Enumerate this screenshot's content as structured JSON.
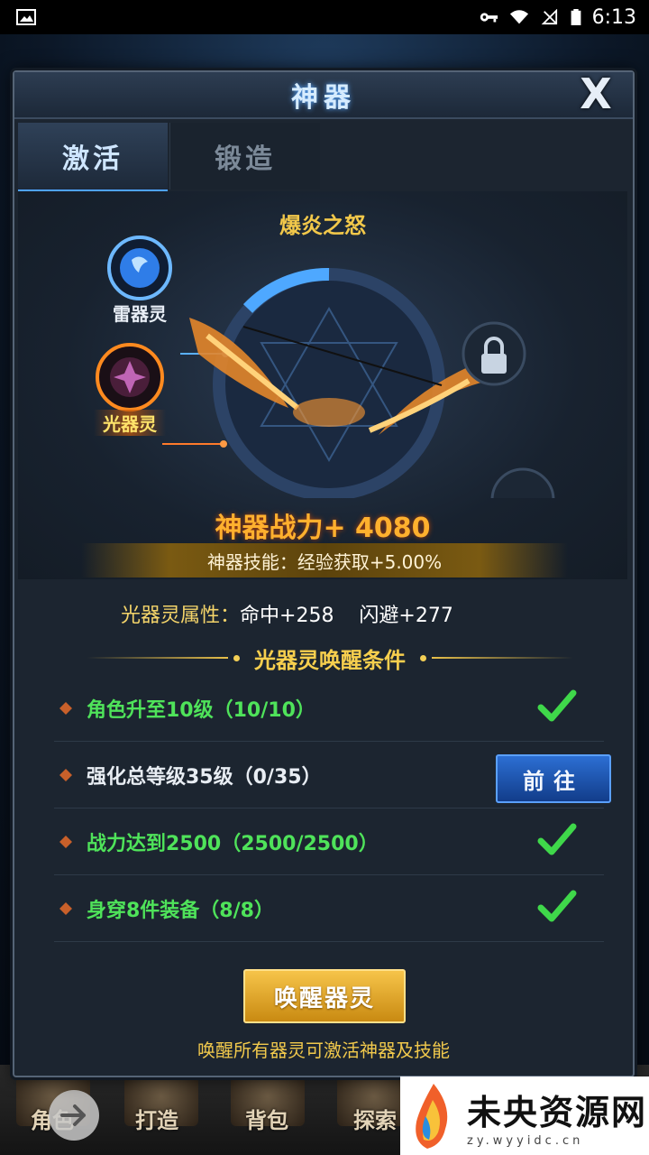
{
  "status_bar": {
    "time": "6:13"
  },
  "dialog": {
    "title": "神器",
    "close_label": "X",
    "tabs": [
      {
        "label": "激活"
      },
      {
        "label": "锻造"
      }
    ]
  },
  "artifact": {
    "name": "爆炎之怒",
    "spirits": [
      {
        "label": "雷器灵",
        "state": "active"
      },
      {
        "label": "光器灵",
        "state": "selected"
      }
    ],
    "power_text": "神器战力+ 4080",
    "skill_text": "神器技能：经验获取+5.00%"
  },
  "attributes": {
    "label": "光器灵属性：",
    "value_text": "命中+258    闪避+277"
  },
  "conditions": {
    "title": "光器灵唤醒条件",
    "items": [
      {
        "text": "角色升至10级（10/10）",
        "done": true
      },
      {
        "text": "强化总等级35级（0/35）",
        "done": false,
        "action_label": "前往"
      },
      {
        "text": "战力达到2500（2500/2500）",
        "done": true
      },
      {
        "text": "身穿8件装备（8/8）",
        "done": true
      }
    ]
  },
  "awaken": {
    "button_label": "唤醒器灵",
    "hint": "唤醒所有器灵可激活神器及技能"
  },
  "bottom_nav": {
    "items": [
      "角色",
      "打造",
      "背包",
      "探索"
    ]
  },
  "watermark": {
    "title": "未央资源网",
    "subtitle": "zy.wyyidc.cn"
  },
  "colors": {
    "done_green": "#4fe35a",
    "gold": "#f2c84a",
    "blue_button": "#2c6fd3"
  }
}
